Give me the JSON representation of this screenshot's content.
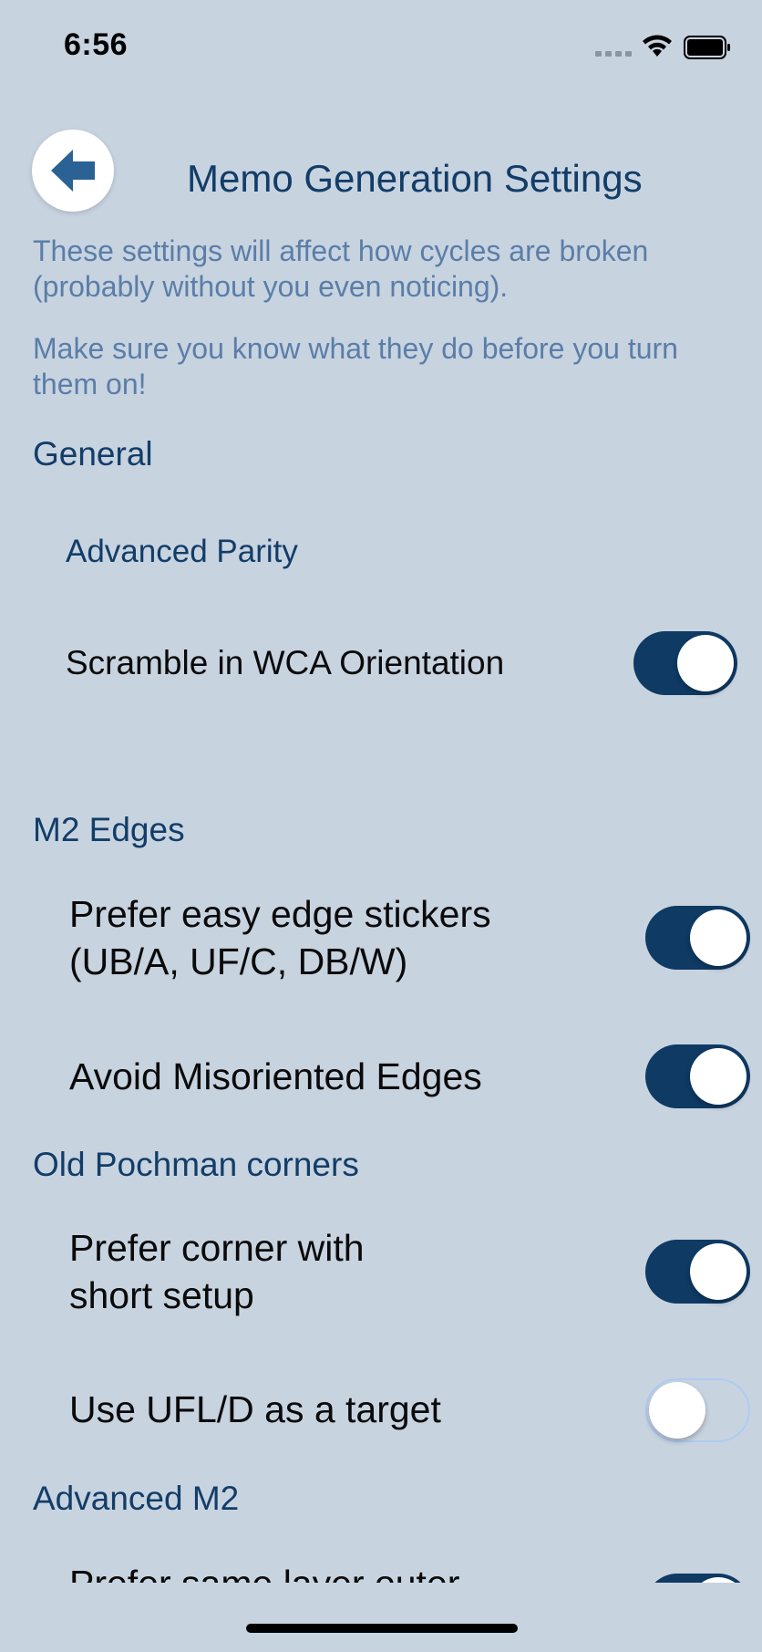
{
  "status_bar": {
    "time": "6:56"
  },
  "header": {
    "title": "Memo Generation Settings"
  },
  "notes": [
    "These settings will affect how cycles are broken (probably without you even noticing).",
    "Make sure you know what they do before you turn them on!"
  ],
  "sections": {
    "general": {
      "title": "General",
      "advanced_parity": "Advanced Parity",
      "scramble_wca": {
        "label": "Scramble in WCA Orientation",
        "on": true
      }
    },
    "m2_edges": {
      "title": "M2 Edges",
      "prefer_easy_line1": "Prefer easy edge stickers",
      "prefer_easy_line2": "(UB/A, UF/C, DB/W)",
      "prefer_easy_on": true,
      "avoid_misoriented": {
        "label": "Avoid Misoriented Edges",
        "on": true
      }
    },
    "old_pochman": {
      "title": "Old Pochman corners",
      "prefer_corner_line1": "Prefer corner with",
      "prefer_corner_line2": "short setup",
      "prefer_corner_on": true,
      "use_ufl": {
        "label": "Use UFL/D as a target",
        "on": false
      }
    },
    "advanced_m2": {
      "title": "Advanced M2",
      "prefer_same_layer": "Prefer same layer outer",
      "prefer_same_layer_on": true
    }
  },
  "colors": {
    "background": "#c8d3e0",
    "accent": "#0e3a64",
    "note_text": "#5a7ea8"
  },
  "icons": {
    "back": "arrow-left-icon",
    "wifi": "wifi-icon",
    "battery": "battery-icon",
    "signal": "cellular-signal-icon"
  }
}
